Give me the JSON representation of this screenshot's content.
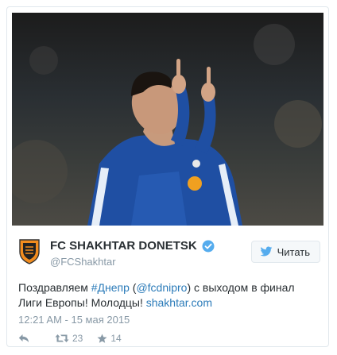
{
  "tweet": {
    "author": {
      "name": "FC SHAKHTAR DONETSK",
      "handle": "@FCShakhtar",
      "verified": true
    },
    "follow_button": {
      "label": "Читать",
      "icon": "twitter-bird-icon"
    },
    "text": {
      "part1": "Поздравляем ",
      "hashtag": "#Днепр",
      "part2": " (",
      "mention": "@fcdnipro",
      "part3": ") с выходом в финал Лиги Европы! Молодцы! ",
      "url": "shakhtar.com"
    },
    "timestamp": "12:21 AM - 15 мая 2015",
    "actions": {
      "reply": {
        "icon": "reply-icon"
      },
      "retweet": {
        "icon": "retweet-icon",
        "count": "23"
      },
      "favorite": {
        "icon": "star-icon",
        "count": "14"
      }
    },
    "colors": {
      "text": "#292f33",
      "muted": "#8899a6",
      "link": "#2b7bb9",
      "verified": "#55acee",
      "shirt": "#1f4fa3"
    }
  }
}
